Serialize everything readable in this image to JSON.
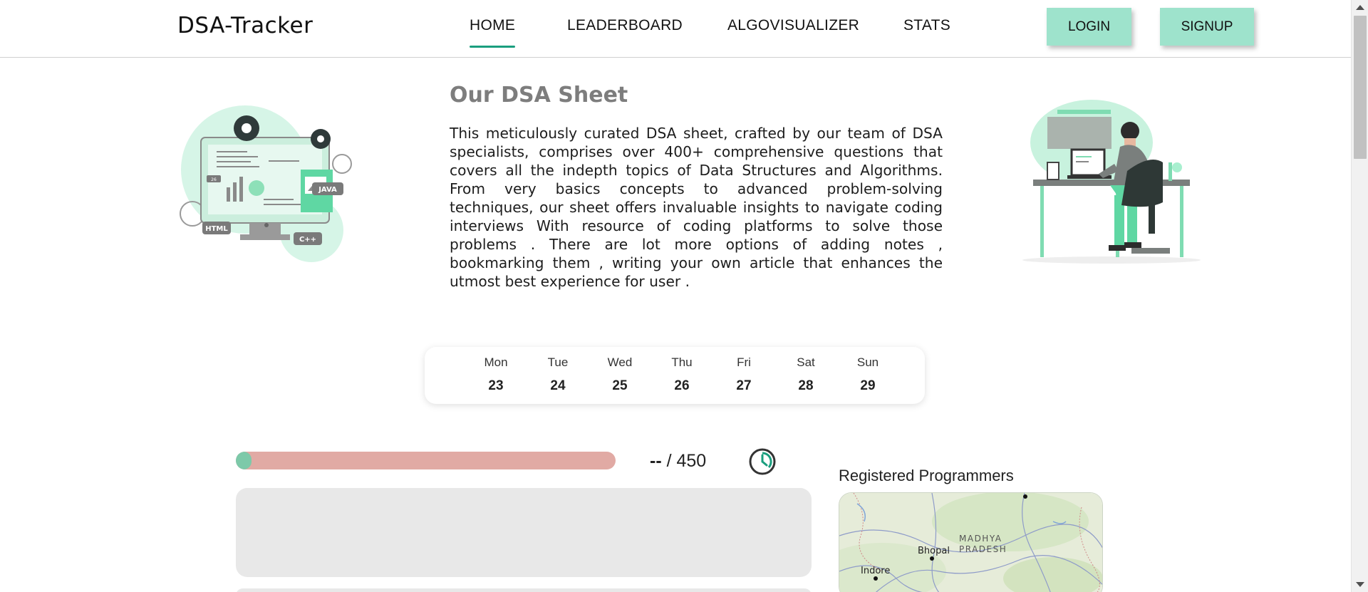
{
  "nav": {
    "brand": "DSA-Tracker",
    "links": [
      "HOME",
      "LEADERBOARD",
      "ALGOVISUALIZER",
      "STATS"
    ],
    "active": "HOME",
    "login_label": "LOGIN",
    "signup_label": "SIGNUP"
  },
  "intro": {
    "title": "Our DSA Sheet",
    "description": "This meticulously curated DSA sheet, crafted by our team of DSA specialists, comprises over 400+ comprehensive questions that covers all the indepth topics of Data Structures and Algorithms. From very basics concepts to advanced problem-solving techniques, our sheet offers invaluable insights to navigate coding interviews With resource of coding platforms to solve those problems . There are lot more options of adding notes , bookmarking them , writing your own article that enhances the utmost best experience for user .",
    "illustration_badges": [
      "HTML",
      "JAVA",
      "C++",
      "26"
    ]
  },
  "week": [
    {
      "day": "Mon",
      "date": "23"
    },
    {
      "day": "Tue",
      "date": "24"
    },
    {
      "day": "Wed",
      "date": "25"
    },
    {
      "day": "Thu",
      "date": "26"
    },
    {
      "day": "Fri",
      "date": "27"
    },
    {
      "day": "Sat",
      "date": "28"
    },
    {
      "day": "Sun",
      "date": "29"
    }
  ],
  "progress": {
    "solved": "--",
    "separator": " / ",
    "total": "450",
    "fraction": 0,
    "fill_color": "#7dc9a9",
    "track_color": "#e1aaa4",
    "timer_icon": "clock-icon"
  },
  "map": {
    "title": "Registered Programmers",
    "labels": {
      "city1": "Bhopal",
      "city2": "Indore",
      "region_line1": "MADHYA",
      "region_line2": "PRADESH"
    }
  },
  "colors": {
    "accent": "#1a9e7e",
    "button_bg": "#9ee3cc",
    "illustration_mint": "#b8f0d8"
  }
}
